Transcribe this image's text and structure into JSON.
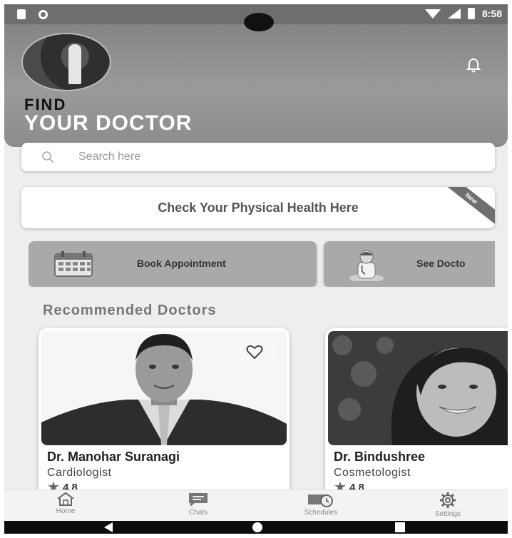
{
  "status_bar": {
    "time": "8:58",
    "icons": [
      "sim-icon",
      "circle-icon",
      "wifi-icon",
      "signal-icon",
      "battery-icon"
    ]
  },
  "header": {
    "title_line1": "FIND",
    "title_line2": "YOUR DOCTOR",
    "icons": [
      "avatar",
      "bell-icon"
    ]
  },
  "search": {
    "placeholder": "Search here",
    "value": ""
  },
  "health_banner": {
    "label": "Check Your Physical Health Here",
    "ribbon": "New"
  },
  "quick_actions": [
    {
      "label": "Book Appointment",
      "icon": "calendar-icon"
    },
    {
      "label": "See Docto",
      "icon": "doctor-icon"
    }
  ],
  "section_title": "Recommended Doctors",
  "doctors": [
    {
      "name": "Dr. Manohar Suranagi",
      "specialty": "Cardiologist",
      "rating": "4.8"
    },
    {
      "name": "Dr. Bindushree",
      "specialty": "Cosmetologist",
      "rating": "4.8"
    }
  ],
  "bottom_nav": [
    {
      "label": "Home",
      "icon": "home-icon"
    },
    {
      "label": "Chats",
      "icon": "chat-icon"
    },
    {
      "label": "Schedules",
      "icon": "schedule-icon"
    },
    {
      "label": "Settings",
      "icon": "gear-icon"
    }
  ],
  "colors": {
    "header": "#8c8c8c",
    "background": "#eeeeee",
    "action_card": "#a9a9a9",
    "system_bar": "#0d0d0d"
  }
}
